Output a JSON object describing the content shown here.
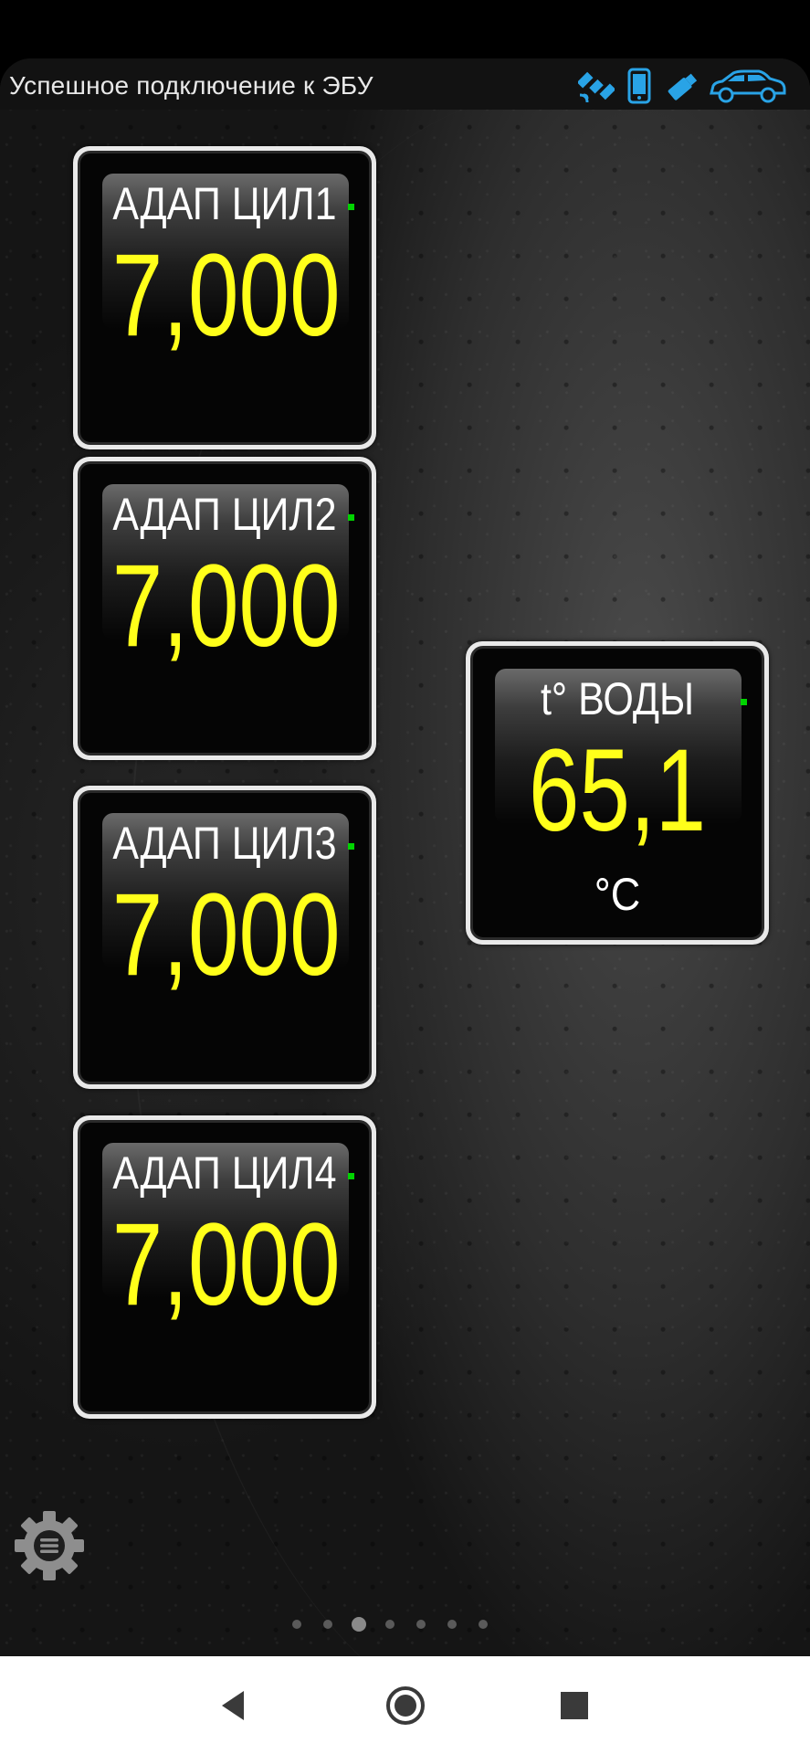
{
  "status": {
    "text": "Успешное подключение к ЭБУ"
  },
  "top_icons": [
    "satellite-icon",
    "phone-icon",
    "usb-adapter-icon",
    "car-icon"
  ],
  "colors": {
    "accent": "#29a3e6",
    "value": "#ffff1a",
    "indicator": "#00d400"
  },
  "gauges": [
    {
      "label": "АДАП ЦИЛ1",
      "value": "7,000",
      "unit": ""
    },
    {
      "label": "АДАП ЦИЛ2",
      "value": "7,000",
      "unit": ""
    },
    {
      "label": "АДАП ЦИЛ3",
      "value": "7,000",
      "unit": ""
    },
    {
      "label": "АДАП ЦИЛ4",
      "value": "7,000",
      "unit": ""
    },
    {
      "label": "t° ВОДЫ",
      "value": "65,1",
      "unit": "°C"
    }
  ],
  "pager": {
    "pages": 7,
    "current": 3
  },
  "nav": [
    "back-icon",
    "home-icon",
    "recents-icon"
  ]
}
